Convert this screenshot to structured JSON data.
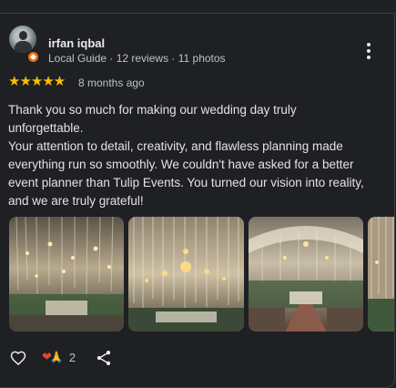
{
  "review": {
    "author_name": "irfan iqbal",
    "author_meta": "Local Guide · 12 reviews · 11 photos",
    "rating": 5,
    "stars_text": "★★★★★",
    "time_ago": "8 months ago",
    "text_lines": [
      "Thank you so much for making our wedding day truly",
      "unforgettable.",
      "Your attention to detail, creativity, and flawless planning made",
      "everything run so smoothly. We couldn't have asked for a better",
      "event planner than Tulip Events. You turned our vision into reality,",
      "and we are truly grateful!"
    ],
    "photos_count_visible": 4
  },
  "reactions": {
    "emoji_heart": "❤",
    "emoji_pray": "🙏",
    "count": "2"
  },
  "icons": {
    "avatar": "avatar-photo",
    "badge": "local-guide-badge-icon",
    "more": "more-vert-icon",
    "like": "heart-outline-icon",
    "share": "share-icon"
  },
  "colors": {
    "background": "#1f2023",
    "star": "#fbbc04",
    "text": "#e3e3e3",
    "muted": "#bdc1c6",
    "badge": "#e8710a"
  }
}
